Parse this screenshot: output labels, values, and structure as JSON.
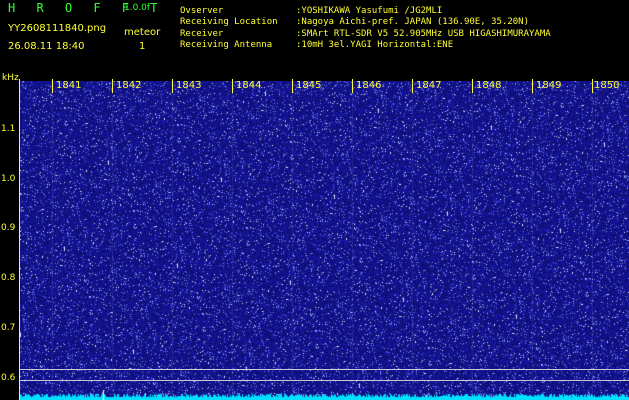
{
  "header": {
    "title": "H R O F F T",
    "version": "1.0.0f",
    "filename": "YY2608111840.png",
    "datetime": "26.08.11 18:40",
    "meteor_label": "meteor",
    "meteor_count": "1"
  },
  "info": [
    {
      "label": "Ovserver",
      "value": ":YOSHIKAWA Yasufumi /JG2MLI"
    },
    {
      "label": "Receiving Location",
      "value": ":Nagoya Aichi-pref. JAPAN (136.90E, 35.20N)"
    },
    {
      "label": "Receiver",
      "value": ":SMArt RTL-SDR V5 52.905MHz USB HIGASHIMURAYAMA"
    },
    {
      "label": "Receiving Antenna",
      "value": ":10mH 3el.YAGI Horizontal:ENE"
    }
  ],
  "axis": {
    "y_unit": "kHz",
    "y_ticks": [
      "1.1",
      "1.0",
      "0.9",
      "0.8",
      "0.7",
      "0.6"
    ],
    "x_ticks": [
      "1841",
      "1842",
      "1843",
      "1844",
      "1845",
      "1846",
      "1847",
      "1848",
      "1849",
      "1850"
    ]
  },
  "colors": {
    "label": "#ffff33",
    "title": "#33ff33",
    "waterfall_bg": "#1a1a9a",
    "spectrum": "#00e0ff"
  }
}
